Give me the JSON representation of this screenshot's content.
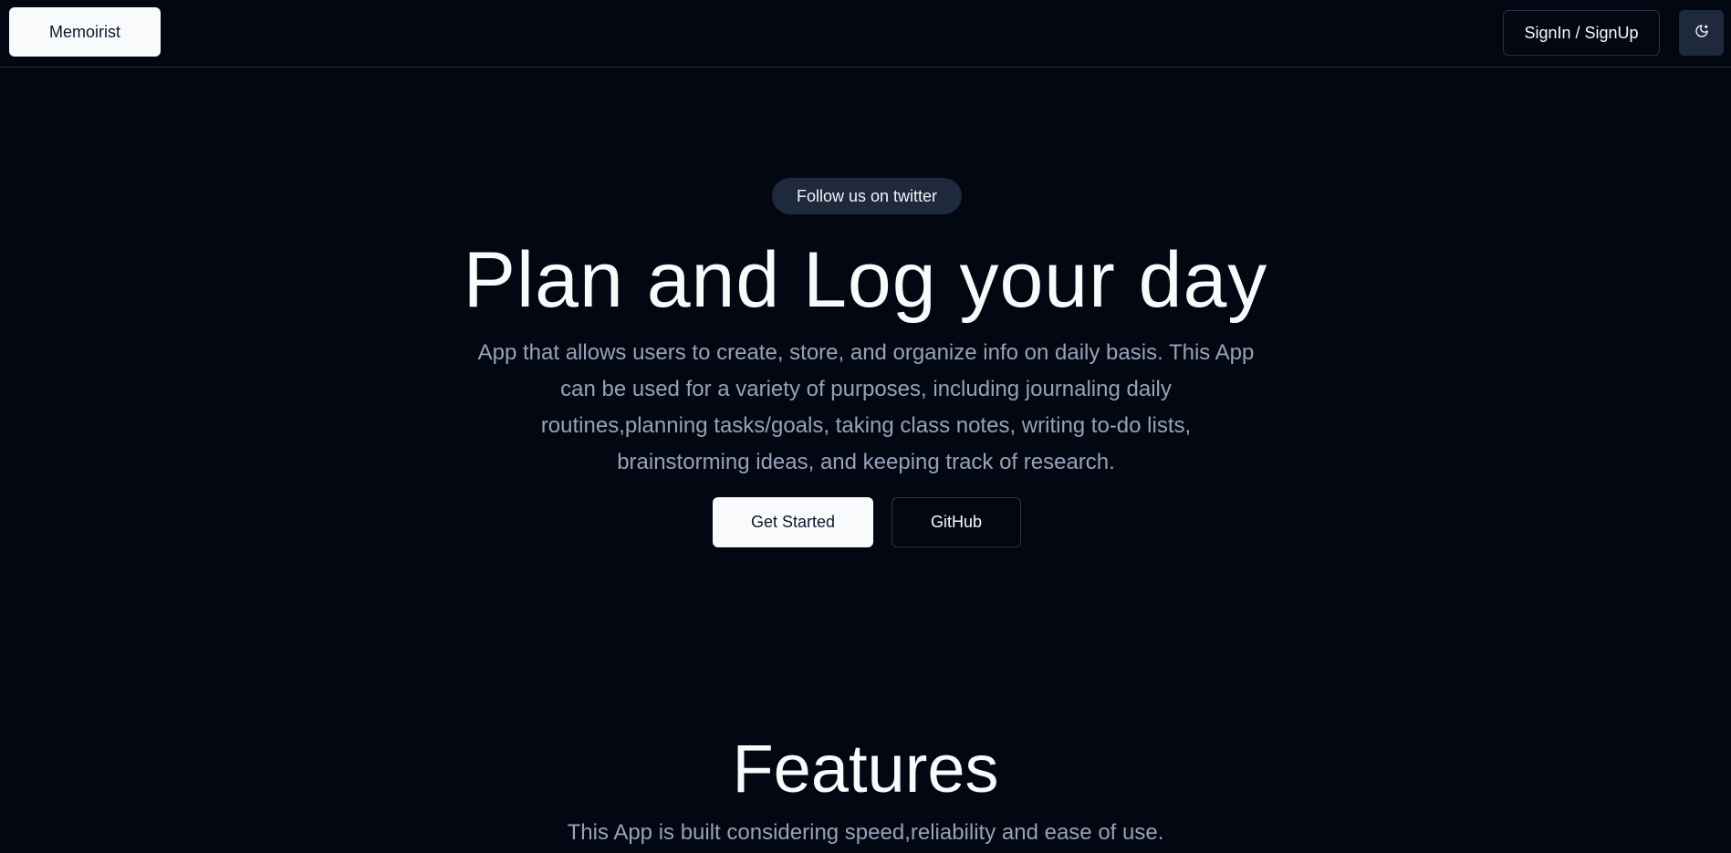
{
  "navbar": {
    "brand_label": "Memoirist",
    "signin_label": "SignIn / SignUp",
    "theme_icon": "moon-sun-toggle-icon"
  },
  "hero": {
    "twitter_pill": "Follow us on twitter",
    "title": "Plan and Log your day",
    "description": "App that allows users to create, store, and organize info on daily basis. This App can be used for a variety of purposes, including journaling daily routines,planning tasks/goals, taking class notes, writing to-do lists, brainstorming ideas, and keeping track of research.",
    "get_started_label": "Get Started",
    "github_label": "GitHub"
  },
  "features": {
    "title": "Features",
    "description": "This App is built considering speed,reliability and ease of use."
  },
  "colors": {
    "background": "#030712",
    "primary_button": "#f8fafc",
    "muted_text": "#94a3b8",
    "pill_background": "#1e293b",
    "border": "#273244"
  }
}
